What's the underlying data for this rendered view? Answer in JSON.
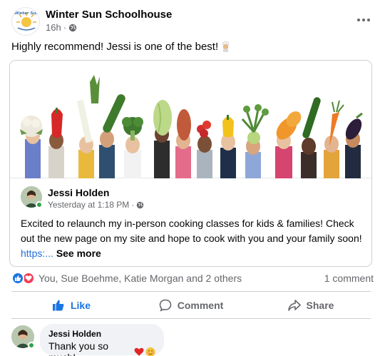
{
  "post": {
    "page_name": "Winter Sun Schoolhouse",
    "logo_text": "Winter Sun",
    "time": "16h",
    "separator": "·",
    "audience_icon": "globe-icon",
    "more_icon": "more-horizontal-icon",
    "text": "Highly recommend! Jessi is one of the best!",
    "text_emoji": "cook-emoji"
  },
  "shared": {
    "image_alt": "Raised hands holding vegetables",
    "author_name": "Jessi Holden",
    "time": "Yesterday at 1:18 PM",
    "separator": "·",
    "audience_icon": "globe-icon",
    "text": "Excited to relaunch my in-person cooking classes for kids & families! Check out the new page on my site and hope to cook with you and your family soon!",
    "link_text": "https:...",
    "see_more": "See more"
  },
  "reactions": {
    "icons": [
      "like-reaction-icon",
      "love-reaction-icon"
    ],
    "names": "You, Sue Boehme, Katie Morgan and 2 others",
    "comment_count": "1 comment"
  },
  "actions": [
    {
      "label": "Like",
      "icon": "thumbs-up-icon",
      "active": true
    },
    {
      "label": "Comment",
      "icon": "comment-icon",
      "active": false
    },
    {
      "label": "Share",
      "icon": "share-icon",
      "active": false
    }
  ],
  "comment": {
    "author": "Jessi Holden",
    "text": "Thank you so much!",
    "emojis": [
      "heart-emoji",
      "blush-emoji"
    ]
  },
  "colors": {
    "accent": "#1b74e4",
    "love": "#f33e58",
    "secondary_text": "#65676b",
    "link": "#216fdb",
    "online": "#31a24c"
  }
}
